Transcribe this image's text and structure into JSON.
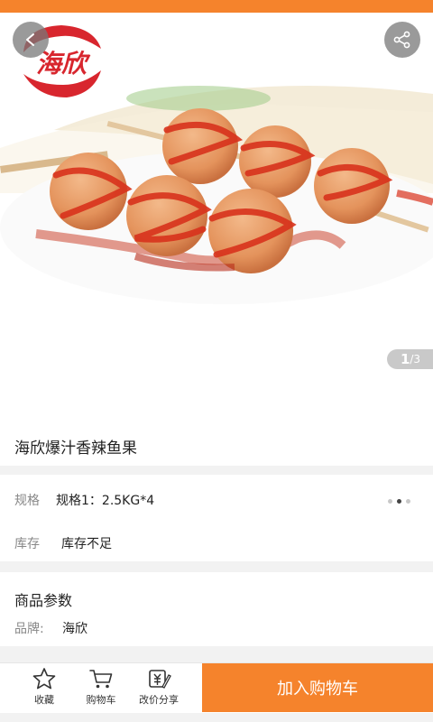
{
  "colors": {
    "accent": "#f5832c",
    "logo_red": "#d8262e"
  },
  "gallery": {
    "current": "1",
    "total": "/3"
  },
  "logo": {
    "text": "海欣"
  },
  "product": {
    "title": "海欣爆汁香辣鱼果"
  },
  "spec": {
    "label": "规格",
    "value": "规格1：2.5KG*4",
    "stock_label": "库存",
    "stock_value": "库存不足"
  },
  "params": {
    "title": "商品参数",
    "brand_label": "品牌:",
    "brand_value": "海欣"
  },
  "bottom_nav": {
    "favorite": "收藏",
    "cart": "购物车",
    "share": "改价分享",
    "add_to_cart": "加入购物车"
  },
  "icons": [
    "back-icon",
    "share-icon",
    "star-icon",
    "cart-icon",
    "price-tag-icon"
  ]
}
